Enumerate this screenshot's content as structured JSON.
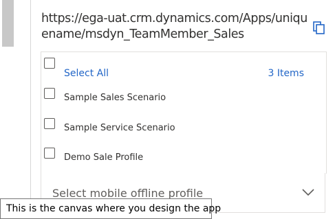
{
  "url": {
    "text": "https://ega-uat.crm.dynamics.com/Apps/uniquename/msdyn_TeamMember_Sales",
    "copy_icon": "copy-icon"
  },
  "profiles": {
    "select_all_label": "Select All",
    "count_label": "3 Items",
    "items": [
      {
        "label": "Sample Sales Scenario",
        "checked": false
      },
      {
        "label": "Sample Service Scenario",
        "checked": false
      },
      {
        "label": "Demo Sale Profile",
        "checked": false
      }
    ]
  },
  "mobile_offline": {
    "placeholder": "Select mobile offline profile",
    "chevron_icon": "chevron-down-icon"
  },
  "tooltip": {
    "text": "This is the canvas where you design the app"
  },
  "colors": {
    "link_blue": "#2266c7",
    "error_red": "#a4262c",
    "text": "#323130"
  }
}
